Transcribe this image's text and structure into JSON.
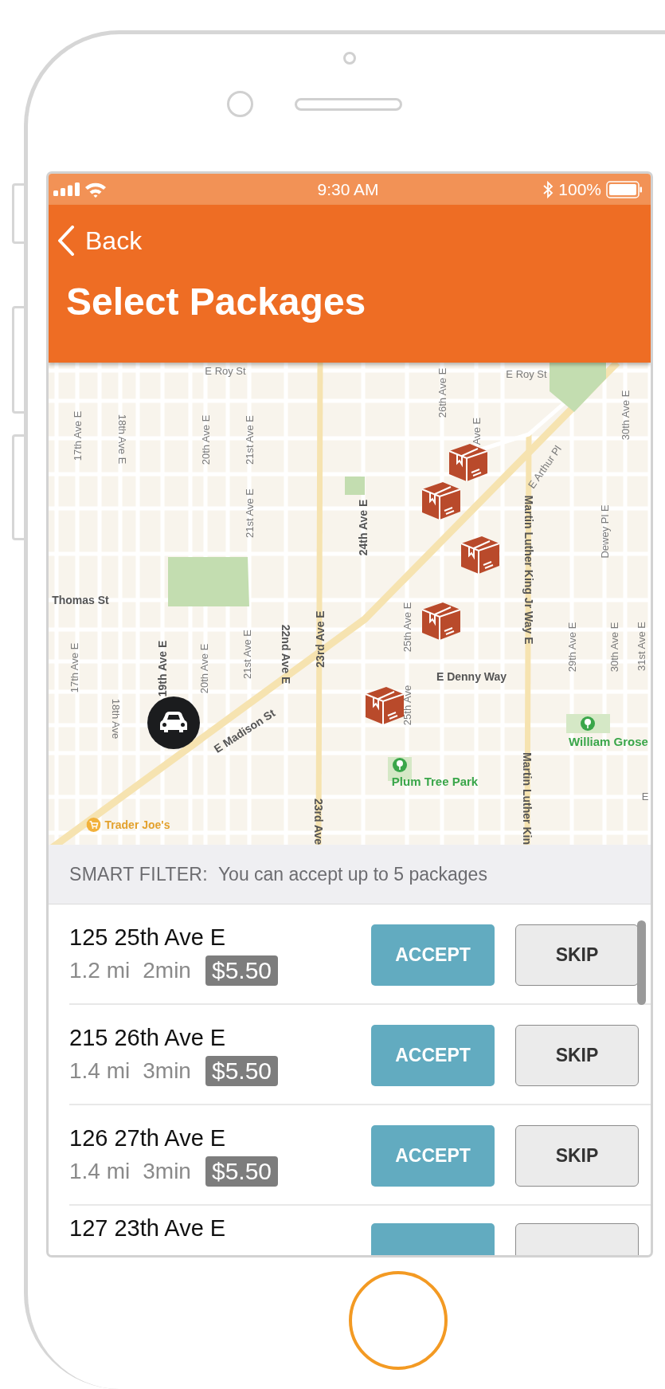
{
  "status_bar": {
    "time": "9:30 AM",
    "battery": "100%"
  },
  "header": {
    "back": "Back",
    "title": "Select Packages"
  },
  "map": {
    "labels": [
      {
        "text": "E Roy St",
        "kind": "street"
      },
      {
        "text": "17th Ave E",
        "kind": "street"
      },
      {
        "text": "18th Ave E",
        "kind": "street"
      },
      {
        "text": "20th Ave E",
        "kind": "street"
      },
      {
        "text": "21st Ave E",
        "kind": "street"
      },
      {
        "text": "21st Ave E",
        "kind": "street"
      },
      {
        "text": "26th Ave E",
        "kind": "street"
      },
      {
        "text": "Ave E",
        "kind": "street"
      },
      {
        "text": "E Roy St",
        "kind": "street"
      },
      {
        "text": "30th Ave E",
        "kind": "street"
      },
      {
        "text": "24th Ave E",
        "kind": "major"
      },
      {
        "text": "E Arthur Pl",
        "kind": "street"
      },
      {
        "text": "Martin Luther King Jr Way E",
        "kind": "major"
      },
      {
        "text": "Dewey Pl E",
        "kind": "street"
      },
      {
        "text": "Thomas St",
        "kind": "major"
      },
      {
        "text": "17th Ave E",
        "kind": "street"
      },
      {
        "text": "19th Ave E",
        "kind": "major"
      },
      {
        "text": "20th Ave E",
        "kind": "street"
      },
      {
        "text": "21st Ave E",
        "kind": "street"
      },
      {
        "text": "22nd Ave E",
        "kind": "major"
      },
      {
        "text": "23rd Ave E",
        "kind": "major"
      },
      {
        "text": "25th Ave E",
        "kind": "street"
      },
      {
        "text": "29th Ave E",
        "kind": "street"
      },
      {
        "text": "30th Ave E",
        "kind": "street"
      },
      {
        "text": "31st Ave E",
        "kind": "street"
      },
      {
        "text": "E Denny Way",
        "kind": "major"
      },
      {
        "text": "18th Ave",
        "kind": "street"
      },
      {
        "text": "25th Ave",
        "kind": "street"
      },
      {
        "text": "E Madison St",
        "kind": "major"
      },
      {
        "text": "William Grose",
        "kind": "park"
      },
      {
        "text": "Plum Tree Park",
        "kind": "park"
      },
      {
        "text": "E",
        "kind": "street"
      },
      {
        "text": "Martin Luther Kin",
        "kind": "major"
      },
      {
        "text": "23rd Ave",
        "kind": "major"
      },
      {
        "text": "Trader Joe's",
        "kind": "poi"
      }
    ],
    "markers": [
      {
        "kind": "package"
      },
      {
        "kind": "package"
      },
      {
        "kind": "package"
      },
      {
        "kind": "package"
      },
      {
        "kind": "package"
      },
      {
        "kind": "vehicle"
      }
    ]
  },
  "smart_filter": {
    "label": "SMART FILTER:",
    "message": "You can accept up to 5 packages"
  },
  "packages": [
    {
      "kind": "full",
      "address": "125 25th Ave E",
      "distance": "1.2 mi",
      "time": "2min",
      "price": "$5.50",
      "accept": "ACCEPT",
      "skip": "SKIP"
    },
    {
      "kind": "full",
      "address": "215 26th Ave E",
      "distance": "1.4 mi",
      "time": "3min",
      "price": "$5.50",
      "accept": "ACCEPT",
      "skip": "SKIP"
    },
    {
      "kind": "full",
      "address": "126 27th Ave E",
      "distance": "1.4 mi",
      "time": "3min",
      "price": "$5.50",
      "accept": "ACCEPT",
      "skip": "SKIP"
    },
    {
      "kind": "partial",
      "address": "127 23th Ave E"
    }
  ]
}
